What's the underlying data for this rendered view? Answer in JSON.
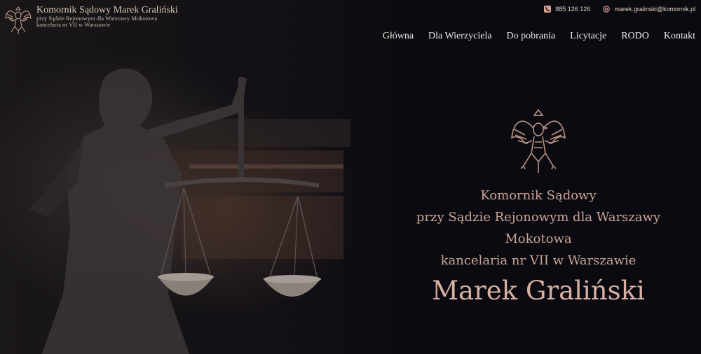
{
  "brand": {
    "title": "Komornik Sądowy Marek Graliński",
    "subtitle_line1": "przy Sądzie Rejonowym dla Warszawy Mokotowa",
    "subtitle_line2": "kancelaria nr VII w Warszawie",
    "logo_icon": "eagle-emblem-icon"
  },
  "contact": {
    "phone": "885 126 126",
    "email": "marek.gralinski@komornik.pl",
    "phone_icon": "phone-icon",
    "email_icon": "at-icon"
  },
  "nav": {
    "items": [
      "Główna",
      "Dla Wierzyciela",
      "Do pobrania",
      "Licytacje",
      "RODO",
      "Kontakt"
    ]
  },
  "hero": {
    "line1": "Komornik Sądowy",
    "line2": "przy Sądzie Rejonowym dla Warszawy",
    "line3": "Mokotowa",
    "line4": "kancelaria nr VII w Warszawie",
    "name": "Marek Graliński"
  },
  "colors": {
    "accent": "#c9a596",
    "background": "#0d0c12",
    "nav_text": "#f0ebe6"
  }
}
